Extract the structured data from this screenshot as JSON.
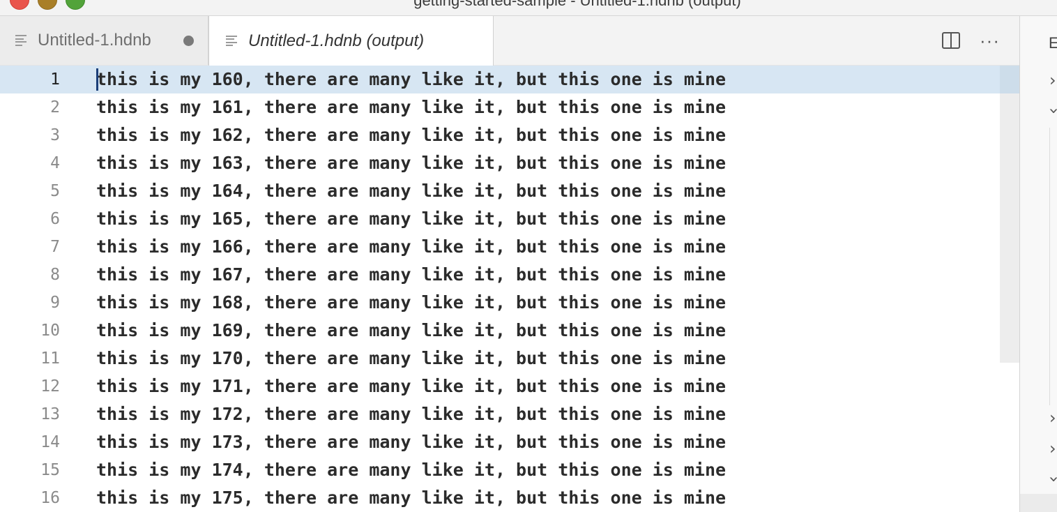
{
  "window": {
    "title": "getting-started-sample - Untitled-1.hdnb (output)"
  },
  "tabs": [
    {
      "label": "Untitled-1.hdnb",
      "dirty": true,
      "active": false
    },
    {
      "label": "Untitled-1.hdnb (output)",
      "active": true
    }
  ],
  "editor_actions": {
    "split_icon": "split-editor-icon",
    "more_label": "···"
  },
  "editor": {
    "current_line": 1,
    "lines": [
      {
        "n": "1",
        "text": "this is my 160, there are many like it, but this one is mine"
      },
      {
        "n": "2",
        "text": "this is my 161, there are many like it, but this one is mine"
      },
      {
        "n": "3",
        "text": "this is my 162, there are many like it, but this one is mine"
      },
      {
        "n": "4",
        "text": "this is my 163, there are many like it, but this one is mine"
      },
      {
        "n": "5",
        "text": "this is my 164, there are many like it, but this one is mine"
      },
      {
        "n": "6",
        "text": "this is my 165, there are many like it, but this one is mine"
      },
      {
        "n": "7",
        "text": "this is my 166, there are many like it, but this one is mine"
      },
      {
        "n": "8",
        "text": "this is my 167, there are many like it, but this one is mine"
      },
      {
        "n": "9",
        "text": "this is my 168, there are many like it, but this one is mine"
      },
      {
        "n": "10",
        "text": "this is my 169, there are many like it, but this one is mine"
      },
      {
        "n": "11",
        "text": "this is my 170, there are many like it, but this one is mine"
      },
      {
        "n": "12",
        "text": "this is my 171, there are many like it, but this one is mine"
      },
      {
        "n": "13",
        "text": "this is my 172, there are many like it, but this one is mine"
      },
      {
        "n": "14",
        "text": "this is my 173, there are many like it, but this one is mine"
      },
      {
        "n": "15",
        "text": "this is my 174, there are many like it, but this one is mine"
      },
      {
        "n": "16",
        "text": "this is my 175, there are many like it, but this one is mine"
      }
    ]
  },
  "sidebar": {
    "header_letter": "E",
    "chevrons": [
      "chevron-right-icon",
      "chevron-down-icon",
      "chevron-right-icon",
      "chevron-right-icon",
      "chevron-down-icon"
    ]
  },
  "colors": {
    "current_line_bg": "#d7e6f3",
    "cursor": "#1a3e78"
  }
}
